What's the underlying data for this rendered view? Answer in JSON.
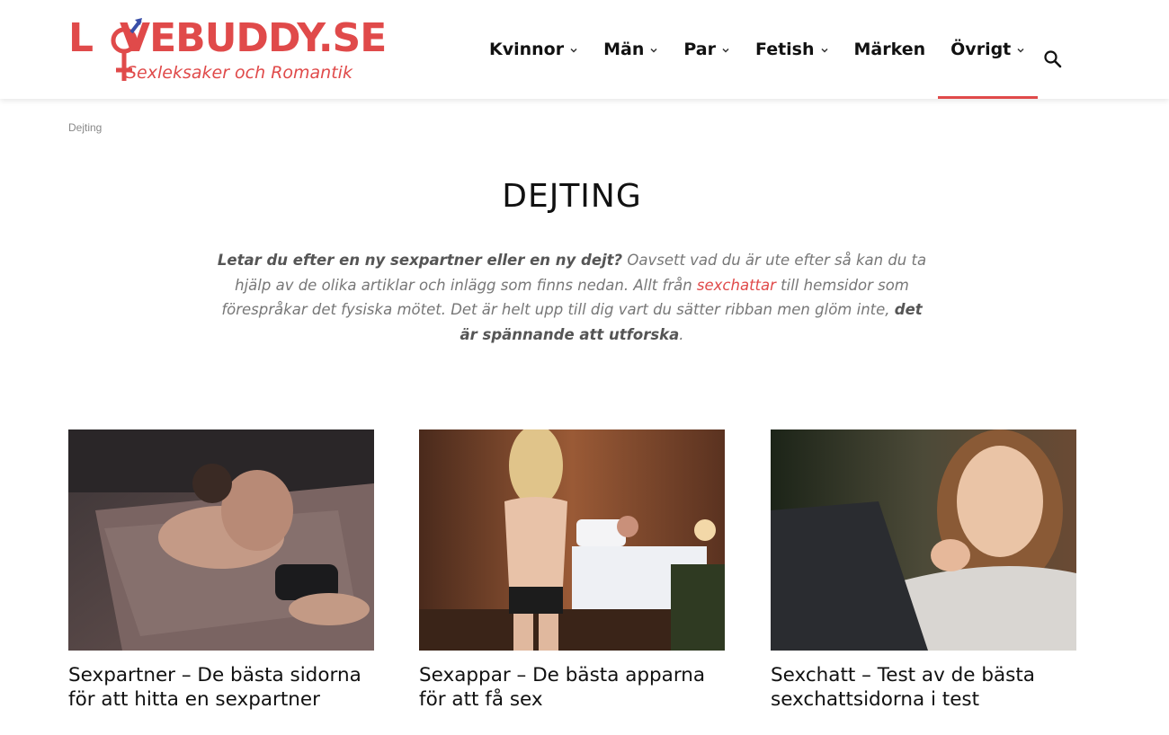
{
  "header": {
    "logo_text_left": "L",
    "logo_text_right": "VEBUDDY.SE",
    "logo_tagline": "Sexleksaker och Romantik",
    "nav": [
      {
        "label": "Kvinnor",
        "dropdown": true,
        "active": false
      },
      {
        "label": "Män",
        "dropdown": true,
        "active": false
      },
      {
        "label": "Par",
        "dropdown": true,
        "active": false
      },
      {
        "label": "Fetish",
        "dropdown": true,
        "active": false
      },
      {
        "label": "Märken",
        "dropdown": false,
        "active": false
      },
      {
        "label": "Övrigt",
        "dropdown": true,
        "active": true
      }
    ],
    "search_icon": "search-icon"
  },
  "breadcrumb": "Dejting",
  "page": {
    "title": "DEJTING",
    "intro": {
      "lead_bold": "Letar du efter en ny sexpartner eller en ny dejt?",
      "text_1": " Oavsett vad du är ute efter så kan du ta hjälp av de olika artiklar och inlägg som finns nedan. Allt från ",
      "link": "sexchattar",
      "text_2": " till hemsidor som förespråkar det fysiska mötet. Det är helt upp till dig vart du sätter ribban men glöm inte, ",
      "end_bold": "det är spännande att utforska",
      "end": "."
    }
  },
  "cards": [
    {
      "title": "Sexpartner – De bästa sidorna för att hitta en sexpartner"
    },
    {
      "title": "Sexappar – De bästa apparna för att få sex"
    },
    {
      "title": "Sexchatt – Test av de bästa sexchattsidorna i test"
    }
  ],
  "colors": {
    "accent": "#e04a4a",
    "logo_blue": "#3a4fa8"
  }
}
